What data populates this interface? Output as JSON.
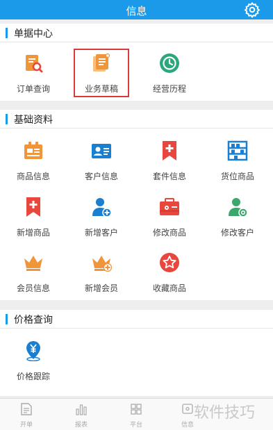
{
  "header": {
    "title": "信息",
    "settings_icon": "gear-icon"
  },
  "sections": {
    "documents": {
      "title": "单据中心",
      "items": [
        {
          "label": "订单查询",
          "icon": "order-search-icon"
        },
        {
          "label": "业务草稿",
          "icon": "draft-document-icon"
        },
        {
          "label": "经营历程",
          "icon": "history-clock-icon"
        }
      ]
    },
    "basics": {
      "title": "基础资料",
      "items": [
        {
          "label": "商品信息",
          "icon": "product-info-icon"
        },
        {
          "label": "客户信息",
          "icon": "customer-card-icon"
        },
        {
          "label": "套件信息",
          "icon": "bookmark-plus-icon"
        },
        {
          "label": "货位商品",
          "icon": "shelf-icon"
        },
        {
          "label": "新增商品",
          "icon": "add-product-icon"
        },
        {
          "label": "新增客户",
          "icon": "add-customer-icon"
        },
        {
          "label": "修改商品",
          "icon": "edit-product-icon"
        },
        {
          "label": "修改客户",
          "icon": "edit-customer-icon"
        },
        {
          "label": "会员信息",
          "icon": "crown-icon"
        },
        {
          "label": "新增会员",
          "icon": "add-member-icon"
        },
        {
          "label": "收藏商品",
          "icon": "star-icon"
        }
      ]
    },
    "price": {
      "title": "价格查询",
      "items": [
        {
          "label": "价格跟踪",
          "icon": "yen-location-icon"
        }
      ]
    }
  },
  "tabbar": {
    "tabs": [
      {
        "label": "开单",
        "icon": "document-icon"
      },
      {
        "label": "报表",
        "icon": "bar-chart-icon"
      },
      {
        "label": "平台",
        "icon": "grid-icon"
      },
      {
        "label": "信息",
        "icon": "info-icon"
      }
    ]
  },
  "watermark": "软件技巧",
  "colors": {
    "header": "#1a9ae8",
    "orange": "#f0953a",
    "red": "#e8473e",
    "blue": "#1a7fd0",
    "teal": "#2aa77b",
    "green": "#3aa86c",
    "highlight": "#d83a3a"
  }
}
